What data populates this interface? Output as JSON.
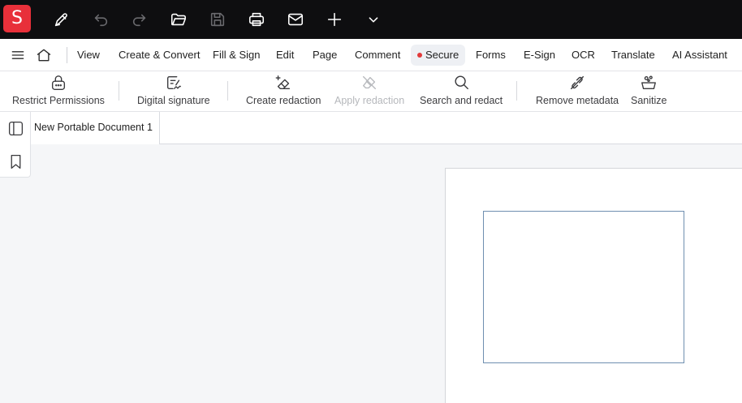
{
  "app": {
    "logo_letter": "S",
    "accent_color": "#e8303a"
  },
  "topbar": {
    "icons": [
      "pen-icon",
      "undo-icon",
      "redo-icon",
      "open-folder-icon",
      "save-icon",
      "print-icon",
      "mail-icon",
      "plus-icon",
      "chevron-down-icon"
    ]
  },
  "menubar": {
    "items": [
      {
        "label": "View"
      },
      {
        "label": "Create & Convert"
      },
      {
        "label": "Fill & Sign"
      },
      {
        "label": "Edit"
      },
      {
        "label": "Page"
      },
      {
        "label": "Comment"
      },
      {
        "label": "Secure",
        "active": true
      },
      {
        "label": "Forms"
      },
      {
        "label": "E-Sign"
      },
      {
        "label": "OCR"
      },
      {
        "label": "Translate"
      },
      {
        "label": "AI Assistant"
      }
    ]
  },
  "ribbon": {
    "tools": [
      {
        "label": "Restrict Permissions",
        "icon": "lock-icon"
      },
      {
        "label": "Digital signature",
        "icon": "signature-icon"
      },
      {
        "label": "Create redaction",
        "icon": "eraser-plus-icon"
      },
      {
        "label": "Apply redaction",
        "icon": "eraser-icon",
        "disabled": true
      },
      {
        "label": "Search and redact",
        "icon": "search-icon"
      },
      {
        "label": "Remove metadata",
        "icon": "remove-metadata-icon"
      },
      {
        "label": "Sanitize",
        "icon": "sanitize-icon"
      }
    ]
  },
  "sidepanel": {
    "icons": [
      "panel-toggle-icon",
      "bookmark-icon"
    ]
  },
  "tabs": [
    {
      "label": "New Portable Document 1",
      "active": true
    }
  ]
}
